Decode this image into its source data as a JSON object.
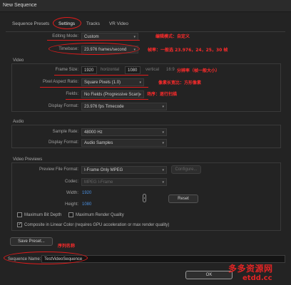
{
  "window": {
    "title": "New Sequence"
  },
  "tabs": [
    {
      "label": "Sequence Presets"
    },
    {
      "label": "Settings"
    },
    {
      "label": "Tracks"
    },
    {
      "label": "VR Video"
    }
  ],
  "settings": {
    "editing_mode_label": "Editing Mode:",
    "editing_mode_value": "Custom",
    "timebase_label": "Timebase:",
    "timebase_value": "23.976 frames/second"
  },
  "video": {
    "section_label": "Video",
    "frame_size_label": "Frame Size:",
    "frame_width": "1920",
    "horizontal_label": "horizontal",
    "frame_height": "1080",
    "vertical_label": "vertical",
    "aspect_ratio": "16:9",
    "pixel_aspect_label": "Pixel Aspect Ratio:",
    "pixel_aspect_value": "Square Pixels (1.0)",
    "fields_label": "Fields:",
    "fields_value": "No Fields (Progressive Scan)",
    "display_format_label": "Display Format:",
    "display_format_value": "23.976 fps Timecode"
  },
  "audio": {
    "section_label": "Audio",
    "sample_rate_label": "Sample Rate:",
    "sample_rate_value": "48000 Hz",
    "display_format_label": "Display Format:",
    "display_format_value": "Audio Samples"
  },
  "previews": {
    "section_label": "Video Previews",
    "file_format_label": "Preview File Format:",
    "file_format_value": "I-Frame Only MPEG",
    "configure_label": "Configure...",
    "codec_label": "Codec:",
    "codec_value": "MPEG I-Frame",
    "width_label": "Width:",
    "width_value": "1920",
    "height_label": "Height:",
    "height_value": "1080",
    "reset_label": "Reset",
    "max_bit_depth_label": "Maximum Bit Depth",
    "max_render_quality_label": "Maximum Render Quality",
    "composite_label": "Composite in Linear Color (requires GPU acceleration or max render quality)",
    "composite_checked": true
  },
  "footer": {
    "save_preset_label": "Save Preset...",
    "sequence_name_label": "Sequence Name:",
    "sequence_name_value": "TestVideoSequence",
    "ok_label": "OK"
  },
  "annotations": {
    "editing_mode": "编辑模式：自定义",
    "timebase": "帧率：一般选 23.976，24，25，30 帧",
    "frame_size": "分辨率（帧一般大小）",
    "pixel_aspect": "像素长宽比：方形像素",
    "fields": "场序：逐行扫描",
    "sequence_name": "序列名称"
  },
  "watermark": {
    "top": "多多资源网",
    "bottom": "etdd.cc"
  }
}
